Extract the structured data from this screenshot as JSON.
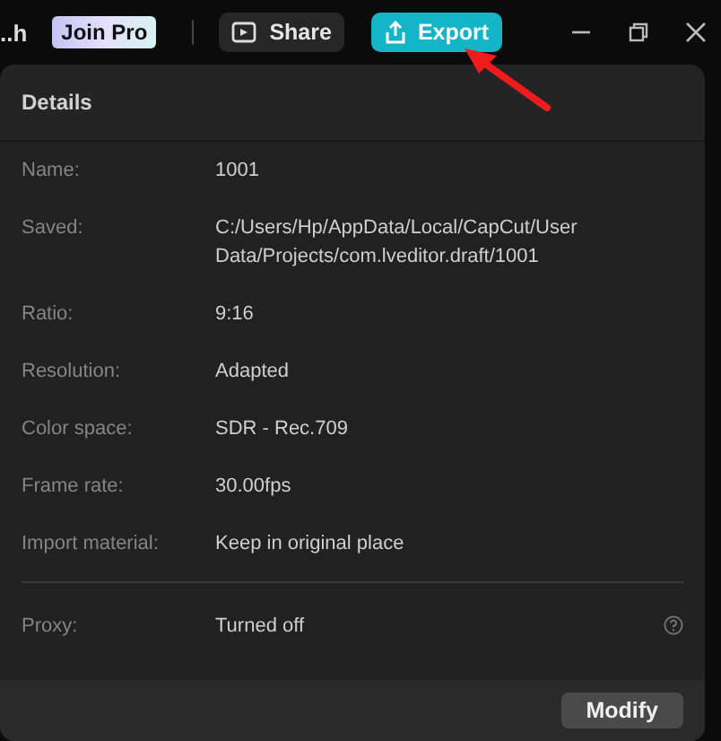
{
  "toolbar": {
    "project_name": "..h",
    "join_pro": "Join Pro",
    "share": "Share",
    "export": "Export"
  },
  "details": {
    "title": "Details",
    "rows": [
      {
        "label": "Name:",
        "value": "1001"
      },
      {
        "label": "Saved:",
        "value": "C:/Users/Hp/AppData/Local/CapCut/User Data/Projects/com.lveditor.draft/1001"
      },
      {
        "label": "Ratio:",
        "value": "9:16"
      },
      {
        "label": "Resolution:",
        "value": "Adapted"
      },
      {
        "label": "Color space:",
        "value": "SDR - Rec.709"
      },
      {
        "label": "Frame rate:",
        "value": "30.00fps"
      },
      {
        "label": "Import material:",
        "value": "Keep in original place"
      }
    ],
    "proxy": {
      "label": "Proxy:",
      "value": "Turned off"
    },
    "button": "Modify"
  }
}
